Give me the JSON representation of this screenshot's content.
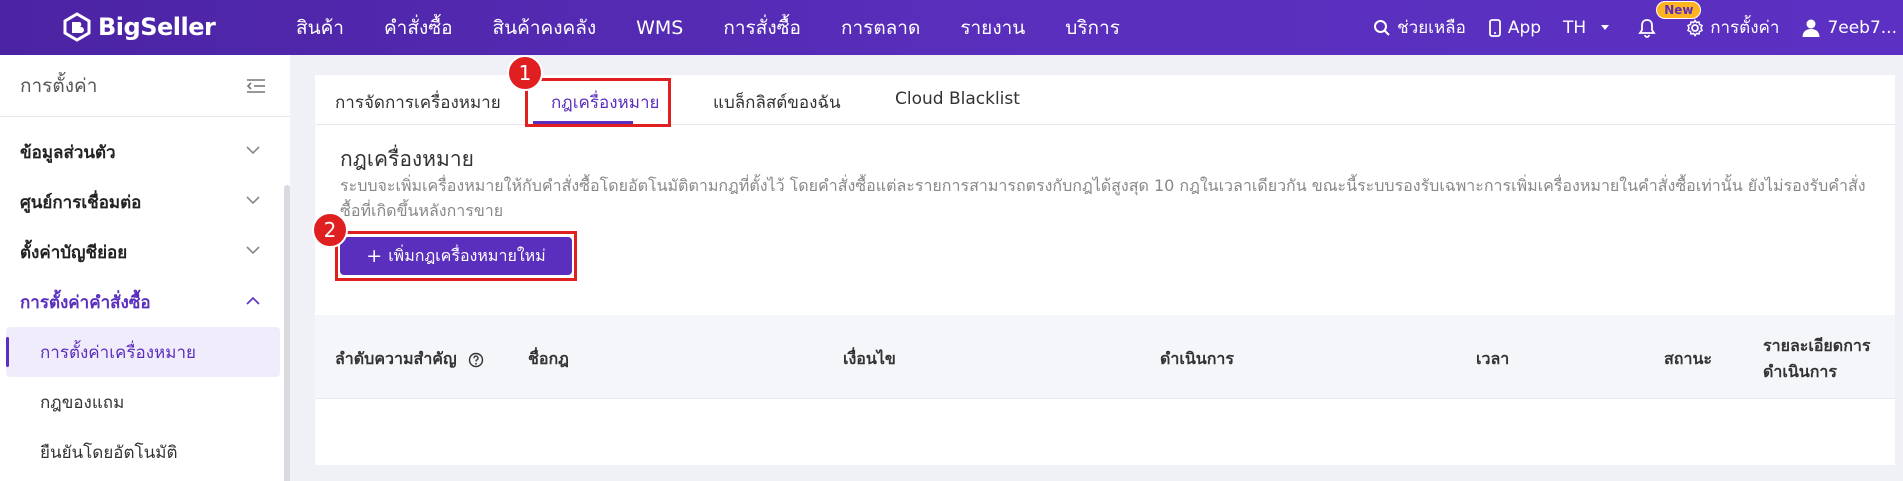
{
  "brand": {
    "name": "BigSeller"
  },
  "topnav": {
    "items": [
      "สินค้า",
      "คำสั่งซื้อ",
      "สินค้าคงคลัง",
      "WMS",
      "การสั่งซื้อ",
      "การตลาด",
      "รายงาน",
      "บริการ"
    ]
  },
  "toolbar": {
    "help_label": "ช่วยเหลือ",
    "app_label": "App",
    "language": "TH",
    "new_badge": "New",
    "settings_label": "การตั้งค่า",
    "user_label": "7eeb7..."
  },
  "sidebar": {
    "title": "การตั้งค่า",
    "groups": [
      {
        "label": "ข้อมูลส่วนตัว"
      },
      {
        "label": "ศูนย์การเชื่อมต่อ"
      },
      {
        "label": "ตั้งค่าบัญชีย่อย"
      },
      {
        "label": "การตั้งค่าคำสั่งซื้อ"
      }
    ],
    "subitems": [
      {
        "label": "การตั้งค่าเครื่องหมาย"
      },
      {
        "label": "กฎของแถม"
      },
      {
        "label": "ยืนยันโดยอัตโนมัติ"
      }
    ]
  },
  "tabs": [
    {
      "label": "การจัดการเครื่องหมาย"
    },
    {
      "label": "กฎเครื่องหมาย"
    },
    {
      "label": "แบล็กลิสต์ของฉัน"
    },
    {
      "label": "Cloud Blacklist"
    }
  ],
  "markers": [
    "1",
    "2"
  ],
  "section": {
    "title": "กฎเครื่องหมาย",
    "description": "ระบบจะเพิ่มเครื่องหมายให้กับคำสั่งซื้อโดยอัตโนมัติตามกฎที่ตั้งไว้ โดยคำสั่งซื้อแต่ละรายการสามารถตรงกับกฎได้สูงสุด 10 กฎในเวลาเดียวกัน ขณะนี้ระบบรองรับเฉพาะการเพิ่มเครื่องหมายในคำสั่งซื้อเท่านั้น ยังไม่รองรับคำสั่งซื้อที่เกิดขึ้นหลังการขาย",
    "add_button": "เพิ่มกฎเครื่องหมายใหม่"
  },
  "table": {
    "columns": [
      "ลำดับความสำคัญ",
      "ชื่อกฎ",
      "เงื่อนไข",
      "ดำเนินการ",
      "เวลา",
      "สถานะ",
      "รายละเอียดการ",
      "ดำเนินการ"
    ]
  },
  "colors": {
    "brand": "#5a2fbd",
    "highlight": "#e02020",
    "badge": "#ffb41f"
  }
}
